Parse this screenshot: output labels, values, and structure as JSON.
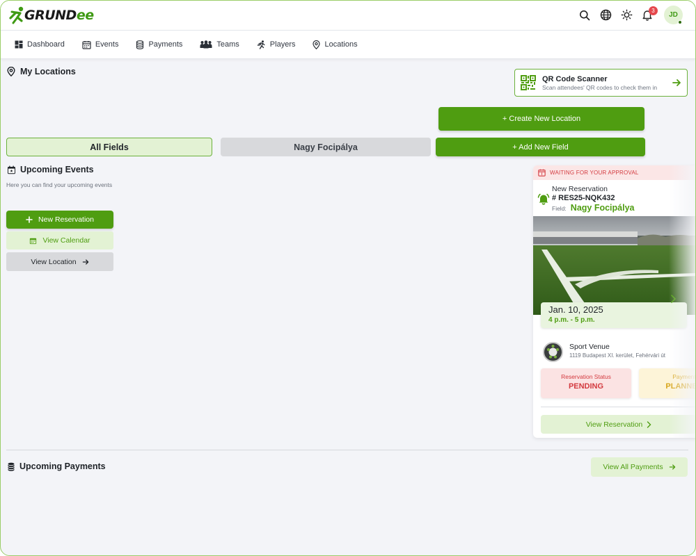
{
  "brand": {
    "logo_main": "GRUND",
    "logo_accent": "ee",
    "accent": "#4f9d11",
    "light_accent": "#e3f2d4"
  },
  "header": {
    "icons": [
      "search-icon",
      "globe-icon",
      "sun-icon",
      "bell-icon"
    ],
    "notification_count": "3",
    "avatar_initials": "JD"
  },
  "nav": {
    "items": [
      {
        "label": "Dashboard",
        "icon": "dashboard-icon"
      },
      {
        "label": "Events",
        "icon": "calendar-icon"
      },
      {
        "label": "Payments",
        "icon": "coins-icon"
      },
      {
        "label": "Teams",
        "icon": "teams-icon"
      },
      {
        "label": "Players",
        "icon": "running-icon"
      },
      {
        "label": "Locations",
        "icon": "location-pin-icon"
      }
    ]
  },
  "page": {
    "title": "My Locations",
    "qr": {
      "title": "QR Code Scanner",
      "subtitle": "Scan attendees' QR codes to check them in"
    },
    "create_location": "+ Create New Location",
    "add_field": "+ Add New Field",
    "tabs": [
      {
        "label": "All Fields"
      },
      {
        "label": "Nagy Focipálya"
      }
    ]
  },
  "upcoming_events": {
    "title": "Upcoming Events",
    "description": "Here you can find your upcoming events",
    "new_reservation": "New Reservation",
    "view_calendar": "View Calendar",
    "view_location": "View Location"
  },
  "reservation": {
    "banner": "WAITING FOR YOUR APPROVAL",
    "label": "New Reservation",
    "id": "# RES25-NQK432",
    "field_label": "Field:",
    "field_name": "Nagy Focipálya",
    "date": "Jan. 10, 2025",
    "time": "4 p.m. - 5 p.m.",
    "venue_name": "Sport Venue",
    "venue_address": "1119 Budapest XI. kerület, Fehérvári út",
    "status_label": "Reservation Status",
    "status_value": "PENDING",
    "payment_label": "Payment",
    "payment_value": "PLANNED",
    "view_button": "View Reservation"
  },
  "upcoming_payments": {
    "title": "Upcoming Payments",
    "view_all": "View All Payments"
  }
}
